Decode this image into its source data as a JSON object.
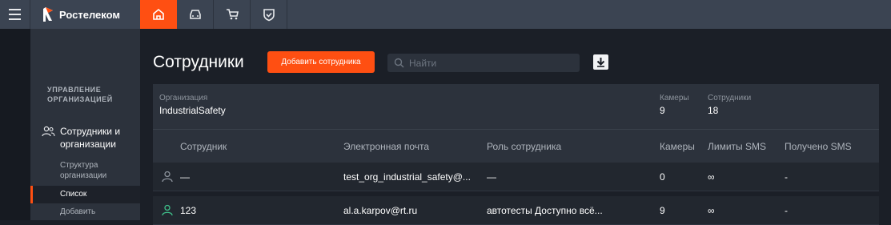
{
  "brand": {
    "name": "Ростелеком"
  },
  "nav": [
    {
      "icon": "home-icon",
      "active": true
    },
    {
      "icon": "car-icon",
      "active": false
    },
    {
      "icon": "cart-icon",
      "active": false
    },
    {
      "icon": "shield-icon",
      "active": false
    }
  ],
  "sidebar": {
    "heading": "УПРАВЛЕНИЕ ОРГАНИЗАЦИЕЙ",
    "section": "Сотрудники и организации",
    "items": [
      "Структура организации",
      "Список",
      "Добавить"
    ],
    "active_index": 1
  },
  "page": {
    "title": "Сотрудники",
    "add_button": "Добавить сотрудника",
    "search_placeholder": "Найти"
  },
  "org": {
    "org_caption": "Организация",
    "org_name": "IndustrialSafety",
    "cameras_caption": "Камеры",
    "cameras": "9",
    "employees_caption": "Сотрудники",
    "employees": "18"
  },
  "table": {
    "headers": [
      "Сотрудник",
      "Электронная почта",
      "Роль сотрудника",
      "Камеры",
      "Лимиты SMS",
      "Получено SMS"
    ],
    "rows": [
      {
        "name": "—",
        "email": "test_org_industrial_safety@...",
        "role": "—",
        "cameras": "0",
        "limits": "∞",
        "received": "-",
        "status": "inactive"
      },
      {
        "name": "123",
        "email": "al.a.karpov@rt.ru",
        "role": "автотесты Доступно всё...",
        "cameras": "9",
        "limits": "∞",
        "received": "-",
        "status": "active"
      }
    ]
  },
  "colors": {
    "accent": "#ff4f12",
    "active_user": "#3fbf8a",
    "inactive_user": "#8c939c"
  }
}
